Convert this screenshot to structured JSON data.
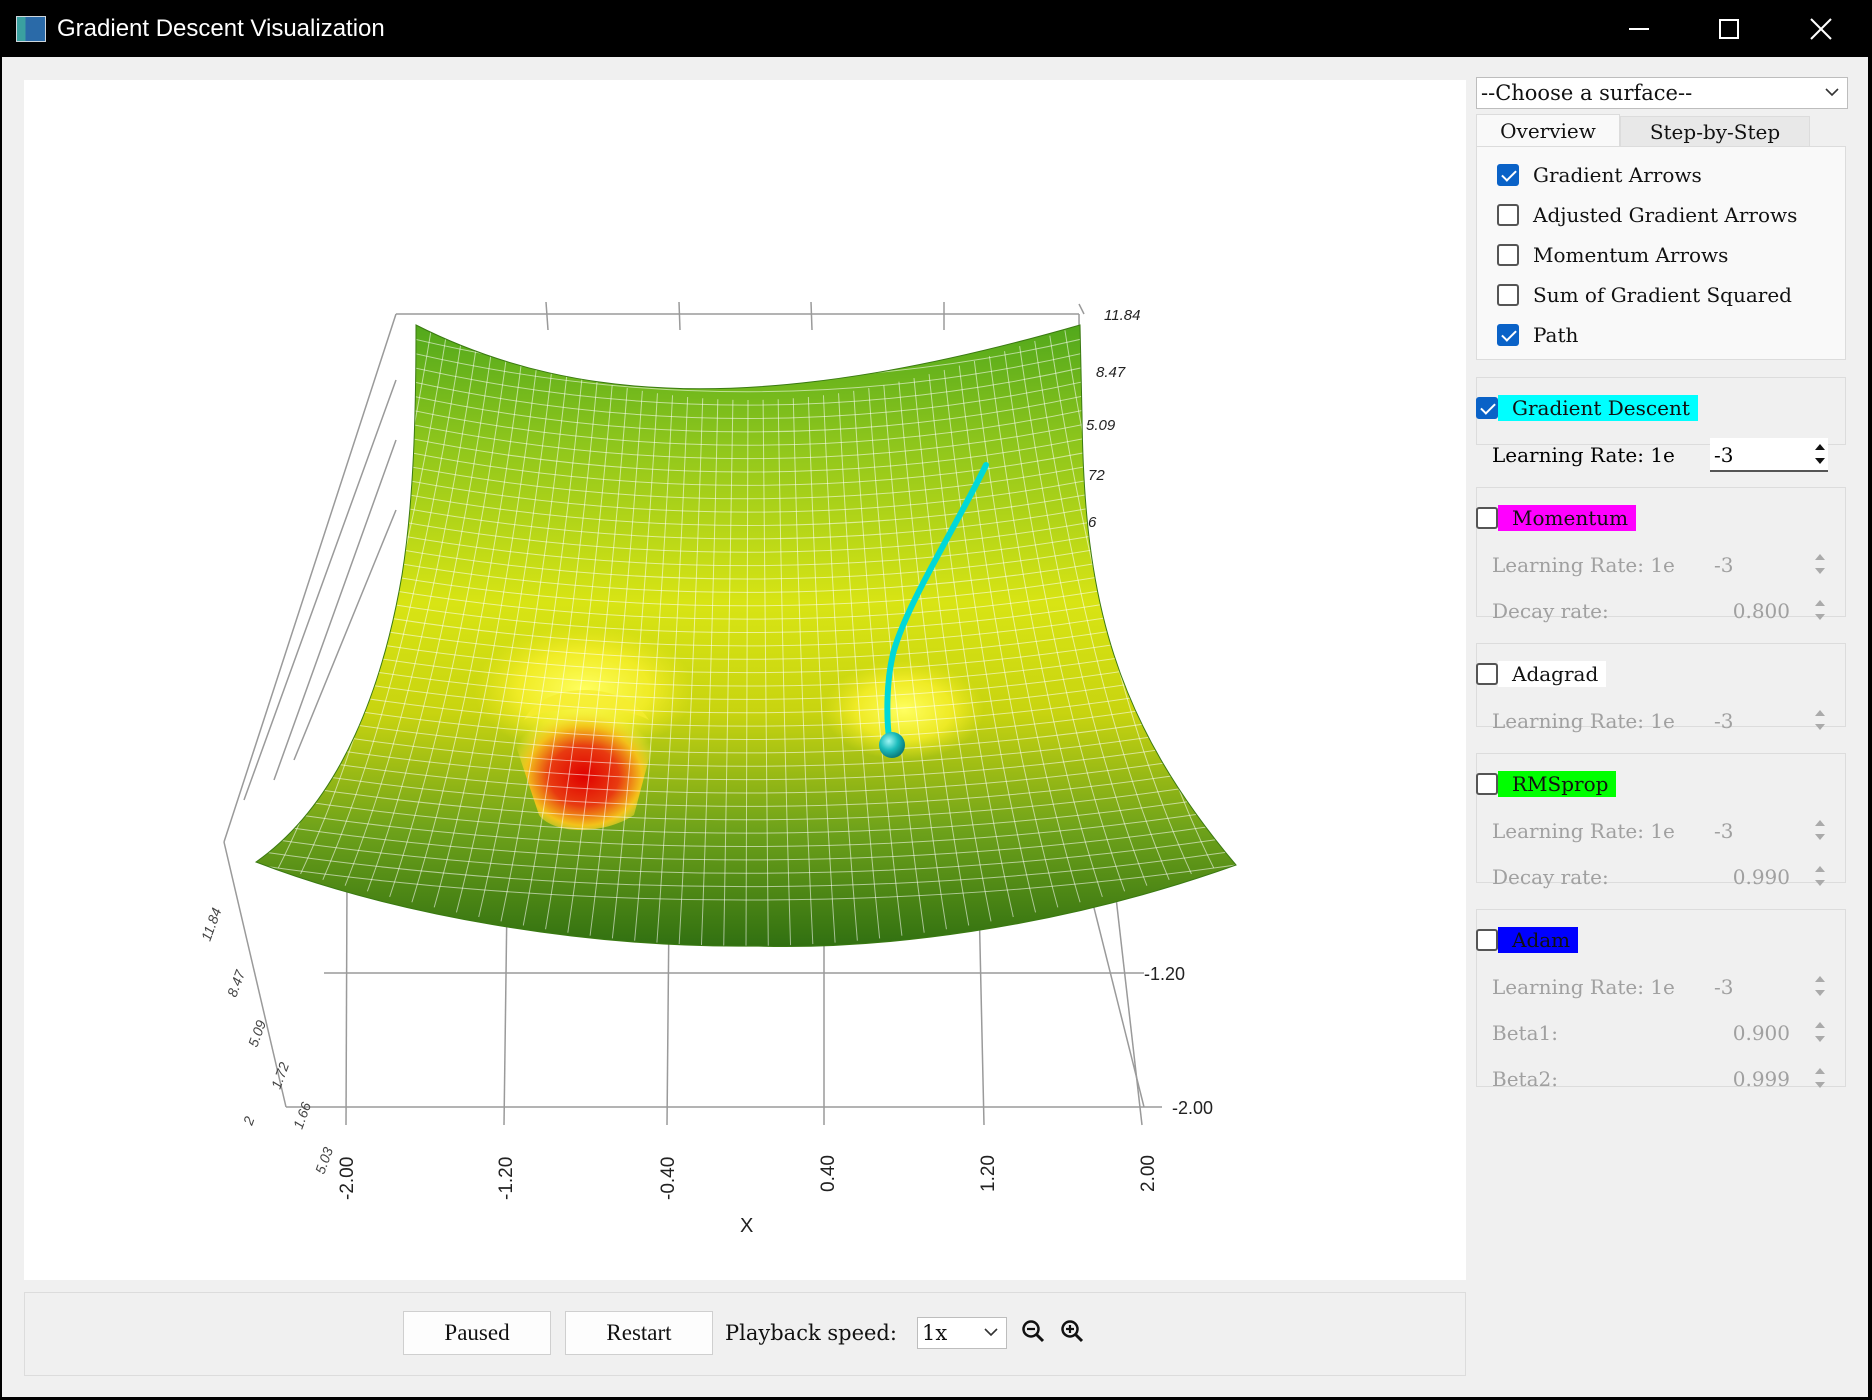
{
  "window": {
    "title": "Gradient Descent Visualization"
  },
  "plot": {
    "z_ticks_right": [
      "11.84",
      "8.47",
      "5.09",
      "72",
      "6"
    ],
    "z_ticks_left": [
      "11.84",
      "8.47",
      "5.09",
      "1.72",
      "1.66",
      "2",
      "5.03"
    ],
    "x_ticks": [
      "-2.00",
      "-1.20",
      "-0.40",
      "0.40",
      "1.20",
      "2.00"
    ],
    "y_ticks": [
      "-1.20",
      "-2.00"
    ],
    "x_label": "X",
    "path_color": "#00d8d8",
    "ball_color": "#1bbcbc"
  },
  "controls": {
    "pause_label": "Paused",
    "restart_label": "Restart",
    "speed_label": "Playback speed:",
    "speed_value": "1x",
    "zoom_out_icon": "zoom-out-icon",
    "zoom_in_icon": "zoom-in-icon"
  },
  "sidebar": {
    "surface_select": "--Choose a surface--",
    "tabs": [
      {
        "label": "Overview"
      },
      {
        "label": "Step-by-Step"
      }
    ],
    "options": [
      {
        "label": "Gradient Arrows",
        "checked": true
      },
      {
        "label": "Adjusted Gradient Arrows",
        "checked": false
      },
      {
        "label": "Momentum Arrows",
        "checked": false
      },
      {
        "label": "Sum of Gradient Squared",
        "checked": false
      },
      {
        "label": "Path",
        "checked": true
      }
    ],
    "optimizers": [
      {
        "name": "Gradient Descent",
        "color": "#00ffff",
        "checked": true,
        "fields": [
          {
            "label": "Learning Rate: 1e",
            "value": "-3"
          }
        ]
      },
      {
        "name": "Momentum",
        "color": "#ff00ff",
        "checked": false,
        "fields": [
          {
            "label": "Learning Rate: 1e",
            "value": "-3"
          },
          {
            "label": "Decay rate:",
            "value": "0.800"
          }
        ]
      },
      {
        "name": "Adagrad",
        "color": "#ffffff",
        "checked": false,
        "fields": [
          {
            "label": "Learning Rate: 1e",
            "value": "-3"
          }
        ]
      },
      {
        "name": "RMSprop",
        "color": "#00ff00",
        "checked": false,
        "fields": [
          {
            "label": "Learning Rate: 1e",
            "value": "-3"
          },
          {
            "label": "Decay rate:",
            "value": "0.990"
          }
        ]
      },
      {
        "name": "Adam",
        "color": "#0000ff",
        "checked": false,
        "fields": [
          {
            "label": "Learning Rate: 1e",
            "value": "-3"
          },
          {
            "label": "Beta1:",
            "value": "0.900"
          },
          {
            "label": "Beta2:",
            "value": "0.999"
          }
        ]
      }
    ]
  }
}
